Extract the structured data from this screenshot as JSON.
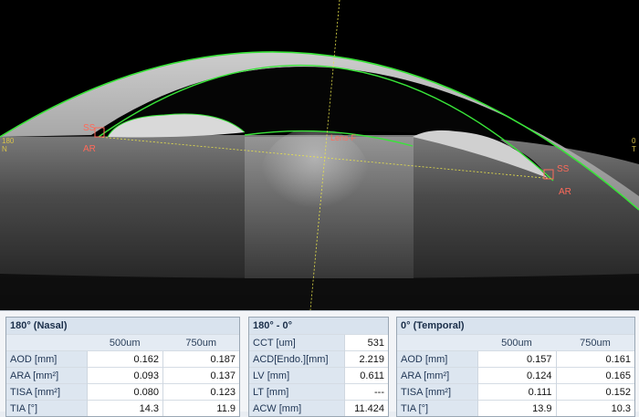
{
  "scan": {
    "left_edge": [
      "180",
      "N"
    ],
    "right_edge": [
      "0",
      "T"
    ],
    "markers": {
      "ss_left": "SS",
      "ar_left": "AR",
      "lens": "Lens-F",
      "ss_right": "SS",
      "ar_right": "AR"
    },
    "colors": {
      "contour": "#39e339",
      "guide": "#e8e34a",
      "marker": "#ff6a5a"
    }
  },
  "nasal": {
    "title": "180° (Nasal)",
    "col_500": "500um",
    "col_750": "750um",
    "rows": [
      {
        "label": "AOD [mm]",
        "v500": "0.162",
        "v750": "0.187"
      },
      {
        "label": "ARA [mm²]",
        "v500": "0.093",
        "v750": "0.137"
      },
      {
        "label": "TISA [mm²]",
        "v500": "0.080",
        "v750": "0.123"
      },
      {
        "label": "TIA [°]",
        "v500": "14.3",
        "v750": "11.9"
      }
    ]
  },
  "center": {
    "title": "180° - 0°",
    "rows": [
      {
        "label": "CCT [um]",
        "value": "531"
      },
      {
        "label": "ACD[Endo.][mm]",
        "value": "2.219"
      },
      {
        "label": "LV [mm]",
        "value": "0.611"
      },
      {
        "label": "LT [mm]",
        "value": "---"
      },
      {
        "label": "ACW [mm]",
        "value": "11.424"
      }
    ]
  },
  "temporal": {
    "title": "0° (Temporal)",
    "col_500": "500um",
    "col_750": "750um",
    "rows": [
      {
        "label": "AOD [mm]",
        "v500": "0.157",
        "v750": "0.161"
      },
      {
        "label": "ARA [mm²]",
        "v500": "0.124",
        "v750": "0.165"
      },
      {
        "label": "TISA [mm²]",
        "v500": "0.111",
        "v750": "0.152"
      },
      {
        "label": "TIA [°]",
        "v500": "13.9",
        "v750": "10.3"
      }
    ]
  }
}
